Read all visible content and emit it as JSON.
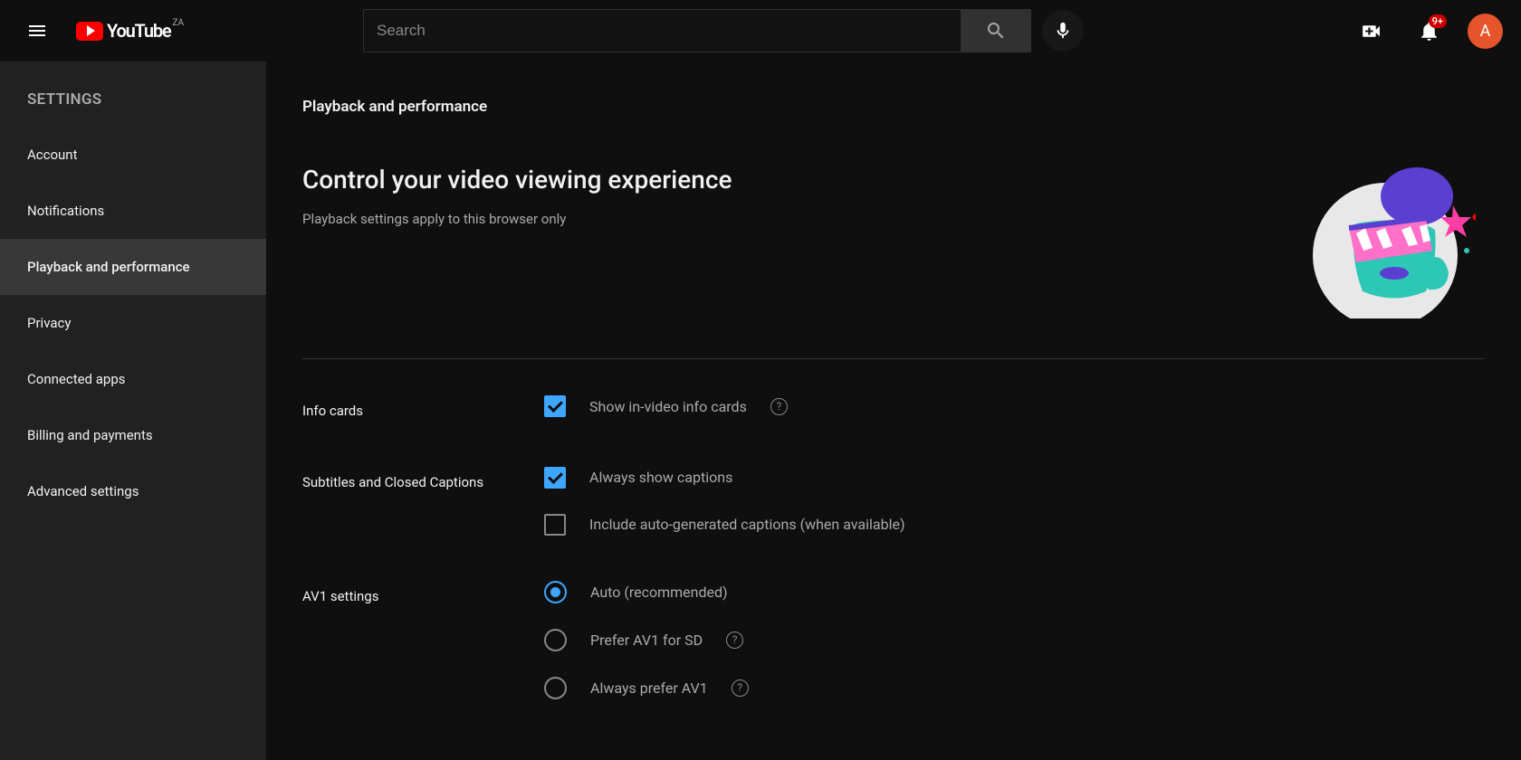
{
  "header": {
    "logo_text": "YouTube",
    "country_code": "ZA",
    "search_placeholder": "Search",
    "notification_badge": "9+",
    "avatar_letter": "A"
  },
  "sidebar": {
    "title": "SETTINGS",
    "items": [
      {
        "label": "Account",
        "active": false
      },
      {
        "label": "Notifications",
        "active": false
      },
      {
        "label": "Playback and performance",
        "active": true
      },
      {
        "label": "Privacy",
        "active": false
      },
      {
        "label": "Connected apps",
        "active": false
      },
      {
        "label": "Billing and payments",
        "active": false
      },
      {
        "label": "Advanced settings",
        "active": false
      }
    ]
  },
  "main": {
    "page_title": "Playback and performance",
    "hero_heading": "Control your video viewing experience",
    "hero_sub": "Playback settings apply to this browser only",
    "sections": {
      "info_cards": {
        "label": "Info cards",
        "option1": "Show in-video info cards",
        "option1_checked": true
      },
      "captions": {
        "label": "Subtitles and Closed Captions",
        "option1": "Always show captions",
        "option1_checked": true,
        "option2": "Include auto-generated captions (when available)",
        "option2_checked": false
      },
      "av1": {
        "label": "AV1 settings",
        "option1": "Auto (recommended)",
        "option1_selected": true,
        "option2": "Prefer AV1 for SD",
        "option2_selected": false,
        "option3": "Always prefer AV1",
        "option3_selected": false
      }
    }
  }
}
